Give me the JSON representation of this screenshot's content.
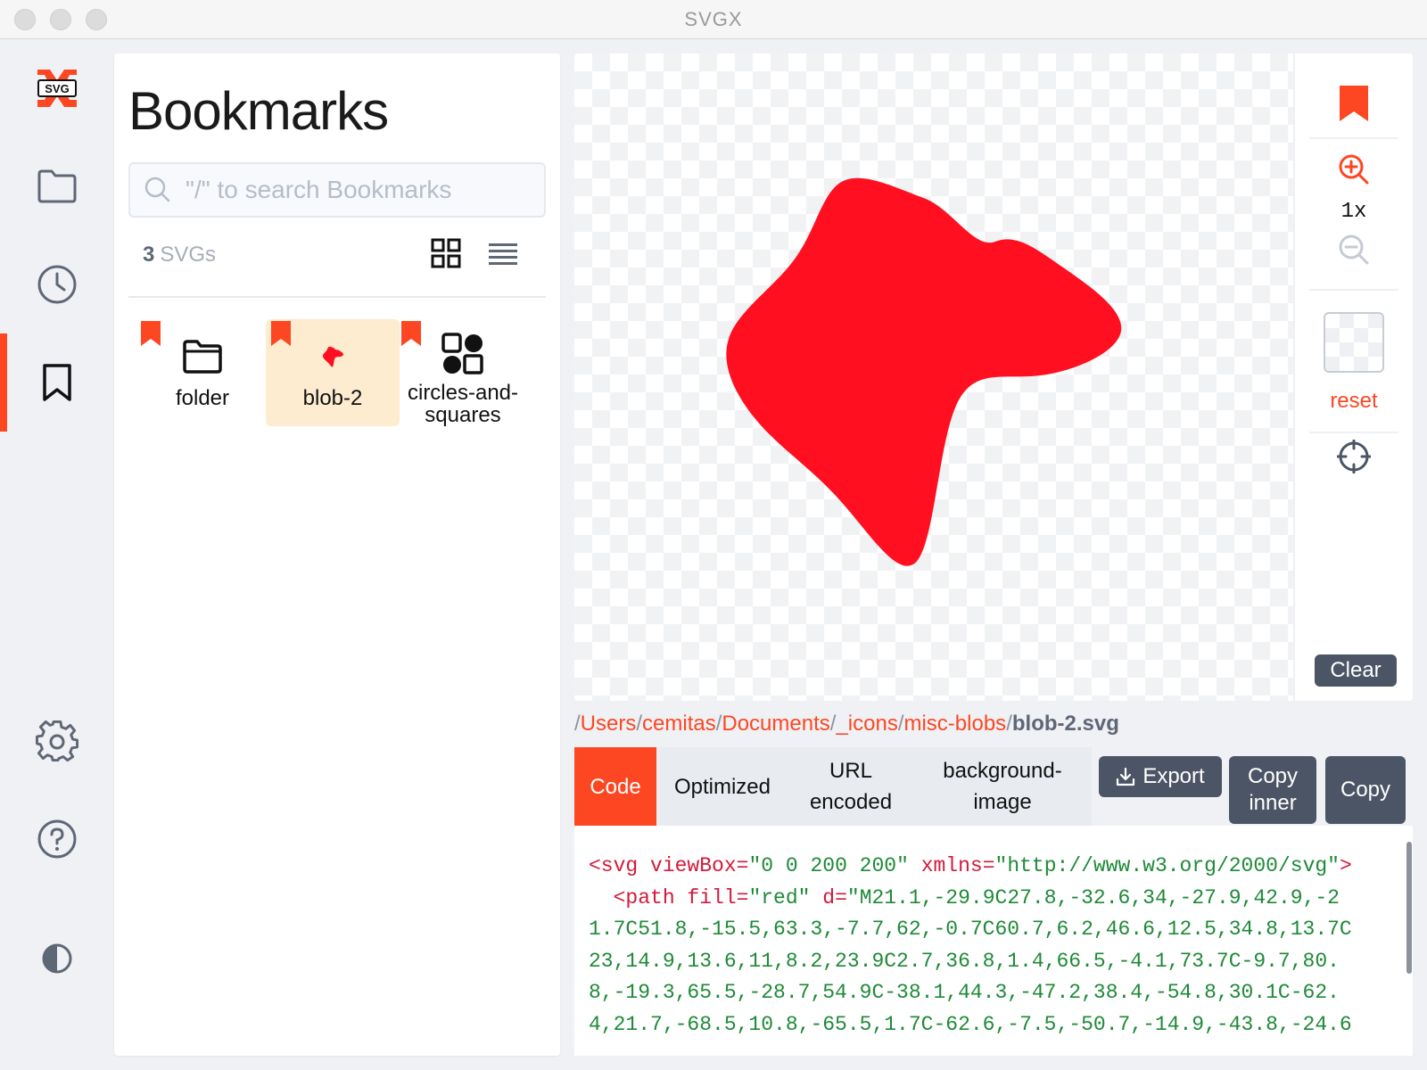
{
  "window": {
    "title": "SVGX"
  },
  "rail": {
    "items": [
      {
        "name": "logo",
        "icon": "svgx-logo-icon",
        "label": "SVG"
      },
      {
        "name": "folders",
        "icon": "folder-icon"
      },
      {
        "name": "recent",
        "icon": "clock-icon"
      },
      {
        "name": "bookmarks",
        "icon": "bookmark-icon",
        "active": true
      },
      {
        "name": "settings",
        "icon": "gear-icon"
      },
      {
        "name": "help",
        "icon": "help-icon"
      },
      {
        "name": "theme",
        "icon": "contrast-icon"
      }
    ],
    "accent": "#fd4722"
  },
  "bookmarks": {
    "title": "Bookmarks",
    "search_placeholder": "\"/\" to search Bookmarks",
    "count_number": "3",
    "count_label": "SVGs",
    "view_modes": [
      "grid-view-icon",
      "list-view-icon"
    ],
    "items": [
      {
        "label": "folder",
        "icon": "folder-icon",
        "bookmarked": true,
        "selected": false
      },
      {
        "label": "blob-2",
        "icon": "blob-thumbnail",
        "bookmarked": true,
        "selected": true
      },
      {
        "label": "circles-and-squares",
        "icon": "circles-and-squares-icon",
        "bookmarked": true,
        "selected": false
      }
    ]
  },
  "preview": {
    "fill": "#ff0f1f",
    "zoom_label": "1x",
    "reset_label": "reset",
    "clear_label": "Clear",
    "tools": [
      "bookmark-icon",
      "zoom-in-icon",
      "zoom-out-icon",
      "background-swatch",
      "crosshair-icon"
    ]
  },
  "path": {
    "separator": "/",
    "crumbs": [
      "Users",
      "cemitas",
      "Documents",
      "_icons",
      "misc-blobs"
    ],
    "file": "blob-2.svg"
  },
  "tabs": [
    {
      "label": "Code",
      "active": true
    },
    {
      "label": "Optimized",
      "active": false
    },
    {
      "label": "URL encoded",
      "active": false
    },
    {
      "label": "background-image",
      "active": false
    }
  ],
  "actions": {
    "export_label": "Export",
    "copy_inner_label": "Copy inner",
    "copy_label": "Copy"
  },
  "code": {
    "line1_tag": "<svg",
    "line1_attr1": " viewBox=",
    "line1_val1": "\"0 0 200 200\"",
    "line1_attr2": " xmlns=",
    "line1_val2": "\"http://www.w3.org/2000/svg\"",
    "line1_end": ">",
    "line2_tag": "  <path",
    "line2_attr1": " fill=",
    "line2_val1": "\"red\"",
    "line2_attr2": " d=",
    "line2_val2": "\"M21.1,-29.9C27.8,-32.6,34,-27.9,42.9,-2",
    "line3": "1.7C51.8,-15.5,63.3,-7.7,62,-0.7C60.7,6.2,46.6,12.5,34.8,13.7C",
    "line4": "23,14.9,13.6,11,8.2,23.9C2.7,36.8,1.4,66.5,-4.1,73.7C-9.7,80.",
    "line5": "8,-19.3,65.5,-28.7,54.9C-38.1,44.3,-47.2,38.4,-54.8,30.1C-62.",
    "line6": "4,21.7,-68.5,10.8,-65.5,1.7C-62.6,-7.5,-50.7,-14.9,-43.8,-24.6"
  }
}
